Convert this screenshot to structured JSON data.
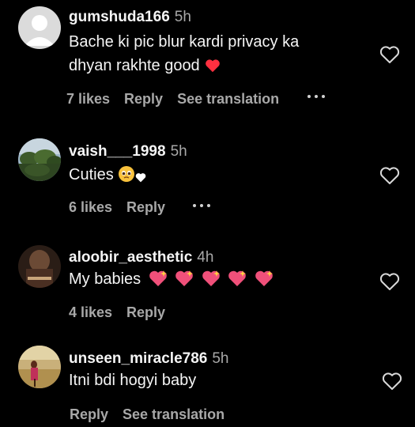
{
  "comments": [
    {
      "username": "gumshuda166",
      "time": "5h",
      "text_lines": [
        "Bache ki pic blur kardi privacy ka",
        "dhyan rakhte good"
      ],
      "emojis": [
        "red-heart"
      ],
      "likes": "7 likes",
      "reply": "Reply",
      "translate": "See translation",
      "avatar": "default-avatar"
    },
    {
      "username": "vaish___1998",
      "time": "5h",
      "text_lines": [
        "Cuties"
      ],
      "emojis": [
        "pleading-face",
        "white-heart"
      ],
      "likes": "6 likes",
      "reply": "Reply",
      "avatar": "landscape-photo"
    },
    {
      "username": "aloobir_aesthetic",
      "time": "4h",
      "text_lines": [
        "My babies"
      ],
      "emojis": [
        "sparkling-heart",
        "sparkling-heart",
        "sparkling-heart",
        "sparkling-heart",
        "sparkling-heart"
      ],
      "likes": "4 likes",
      "reply": "Reply",
      "avatar": "poster-photo"
    },
    {
      "username": "unseen_miracle786",
      "time": "5h",
      "text_lines": [
        "Itni bdi hogyi baby"
      ],
      "likes": "",
      "reply": "Reply",
      "translate": "See translation",
      "avatar": "field-photo"
    }
  ],
  "colors": {
    "background": "#000000",
    "primary_text": "#f5f5f5",
    "secondary_text": "#a8a8a8",
    "red_heart": "#ff3040",
    "sparkle_heart": "#f0507a"
  }
}
